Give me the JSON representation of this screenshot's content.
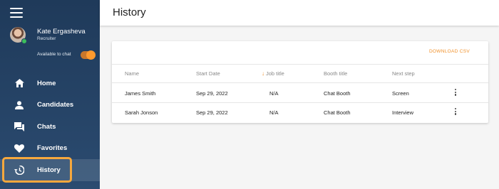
{
  "sidebar": {
    "profile": {
      "name": "Kate Ergasheva",
      "role": "Recruiter"
    },
    "availability": {
      "label": "Available to chat",
      "enabled": true
    },
    "items": [
      {
        "label": "Home",
        "icon": "home-icon"
      },
      {
        "label": "Candidates",
        "icon": "person-icon"
      },
      {
        "label": "Chats",
        "icon": "chat-icon"
      },
      {
        "label": "Favorites",
        "icon": "heart-icon"
      },
      {
        "label": "History",
        "icon": "history-icon",
        "active": true
      }
    ]
  },
  "header": {
    "title": "History"
  },
  "card": {
    "download_label": "DOWNLOAD CSV",
    "columns": [
      "Name",
      "Start Date",
      "Job title",
      "Booth title",
      "Next step"
    ],
    "sort_column": "Job title",
    "rows": [
      {
        "name": "James Smith",
        "start_date": "Sep 29, 2022",
        "job_title": "N/A",
        "booth_title": "Chat Booth",
        "next_step": "Screen"
      },
      {
        "name": "Sarah Jonson",
        "start_date": "Sep 29, 2022",
        "job_title": "N/A",
        "booth_title": "Chat Booth",
        "next_step": "Interview"
      }
    ]
  },
  "colors": {
    "accent": "#f0902a",
    "sidebar": "#24405f",
    "highlight": "#f7a83d",
    "online": "#3cbf5c"
  }
}
